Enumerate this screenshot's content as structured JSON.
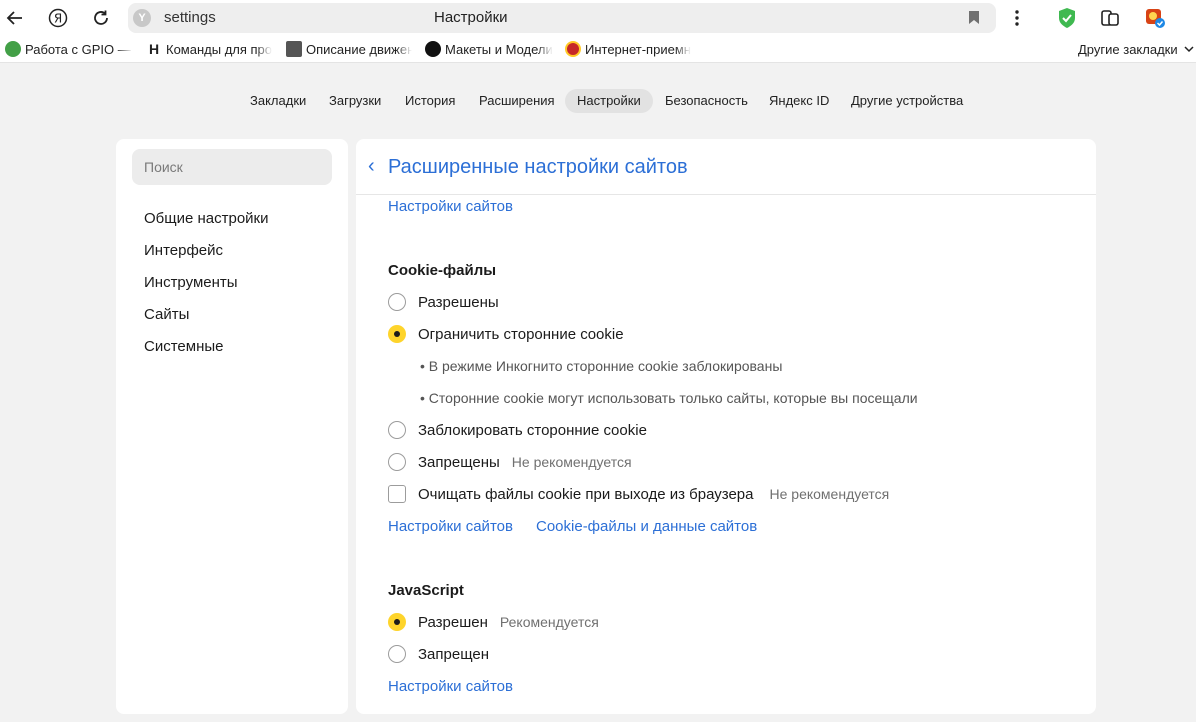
{
  "toolbar": {
    "back_icon": "arrow-left-icon",
    "yandex_icon": "yandex-logo-icon",
    "reload_icon": "reload-icon",
    "address": "settings",
    "page_title": "Настройки",
    "menu_icon": "kebab-menu-icon"
  },
  "bookmarks": {
    "items": [
      {
        "label": "Работа с GPIO — \\",
        "icon": "wiki-favicon",
        "color": "#43a047"
      },
      {
        "label": "Команды для про",
        "icon": "h-favicon",
        "color": "#222222"
      },
      {
        "label": "Описание движен",
        "icon": "doc-favicon",
        "color": "#555555"
      },
      {
        "label": "Макеты и Модели",
        "icon": "dark-circle-favicon",
        "color": "#111111"
      },
      {
        "label": "Интернет-приемн",
        "icon": "emblem-favicon",
        "color": "#c62828"
      }
    ],
    "other": "Другие закладки"
  },
  "nav": {
    "items": [
      "Закладки",
      "Загрузки",
      "История",
      "Расширения",
      "Настройки",
      "Безопасность",
      "Яндекс ID",
      "Другие устройства"
    ],
    "active": "Настройки"
  },
  "sidebar": {
    "search_placeholder": "Поиск",
    "items": [
      "Общие настройки",
      "Интерфейс",
      "Инструменты",
      "Сайты",
      "Системные"
    ]
  },
  "main": {
    "title": "Расширенные настройки сайтов",
    "top_link": "Настройки сайтов",
    "cookies": {
      "title": "Cookie-файлы",
      "allowed": "Разрешены",
      "limit": "Ограничить сторонние cookie",
      "bullet1": "• В режиме Инкогнито сторонние cookie заблокированы",
      "bullet2": "• Сторонние cookie могут использовать только сайты, которые вы посещали",
      "block": "Заблокировать сторонние cookie",
      "forbidden": "Запрещены",
      "forbidden_hint": "Не рекомендуется",
      "clear_on_exit": "Очищать файлы cookie при выходе из браузера",
      "clear_hint": "Не рекомендуется",
      "link_sites": "Настройки сайтов",
      "link_data": "Cookie-файлы и данные сайтов",
      "selected": "Ограничить сторонние cookie"
    },
    "javascript": {
      "title": "JavaScript",
      "allowed": "Разрешен",
      "allowed_hint": "Рекомендуется",
      "forbidden": "Запрещен",
      "link_sites": "Настройки сайтов",
      "selected": "Разрешен"
    }
  },
  "colors": {
    "accent": "#2c6fd6",
    "radio_selected": "#fed42b",
    "page_bg": "#f2f2f2"
  }
}
